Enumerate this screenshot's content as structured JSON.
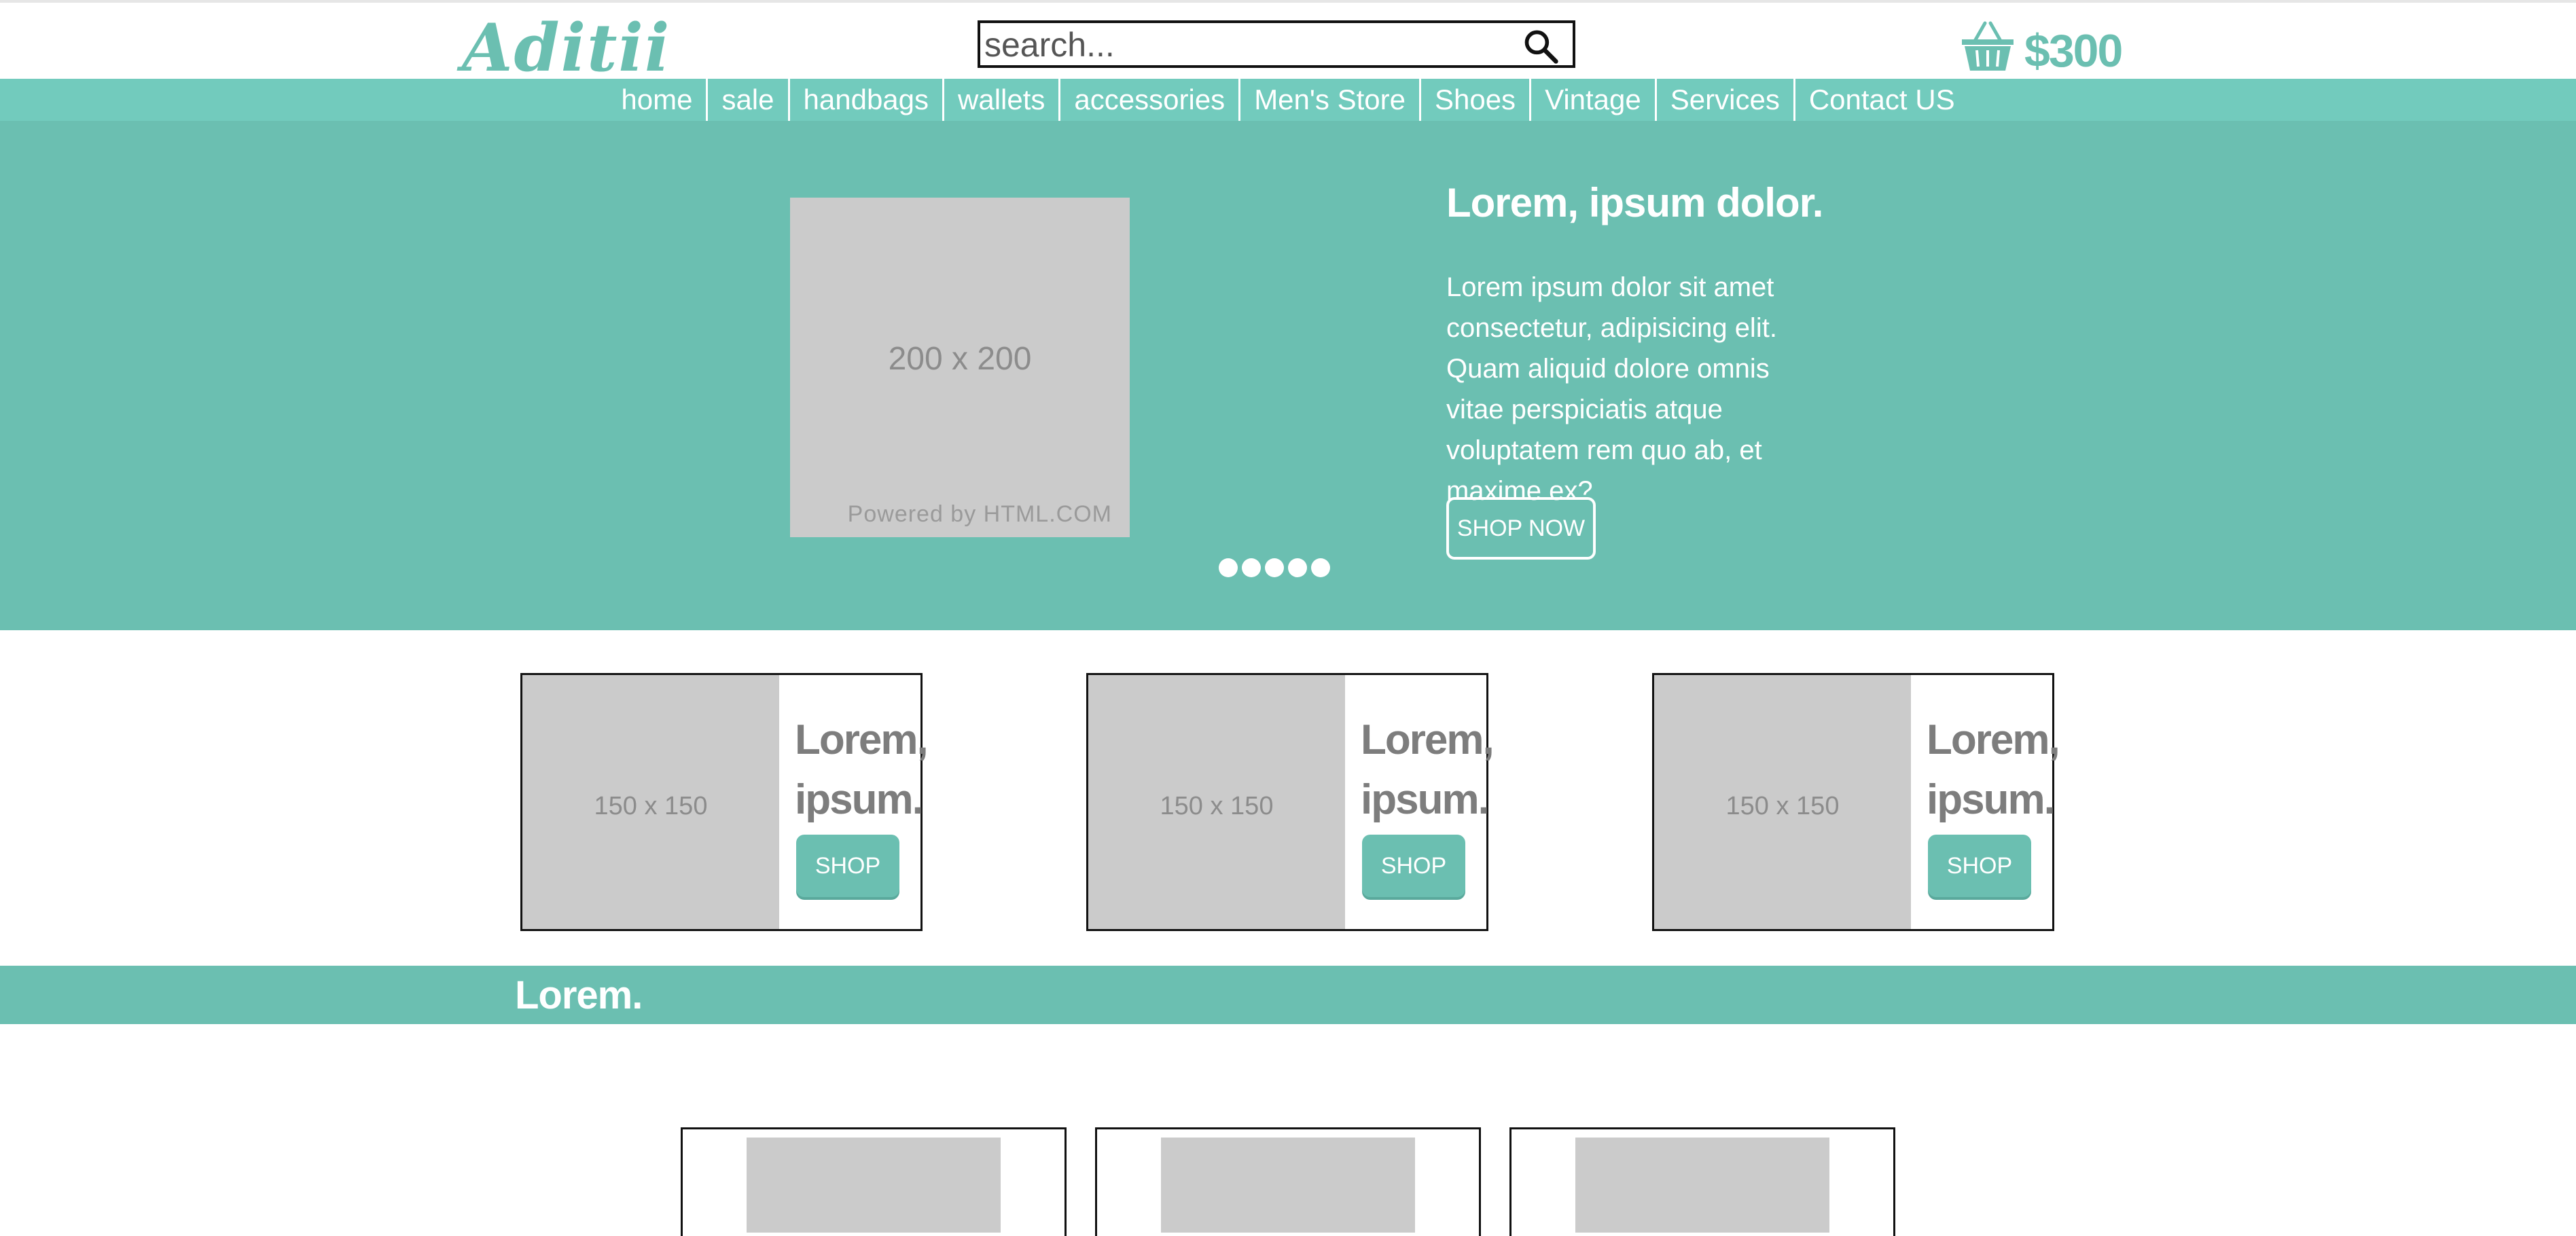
{
  "header": {
    "logo": "Aditii",
    "search_placeholder": "search...",
    "cart_total": "$300"
  },
  "nav": {
    "items": [
      "home",
      "sale",
      "handbags",
      "wallets",
      "accessories",
      "Men's Store",
      "Shoes",
      "Vintage",
      "Services",
      "Contact US"
    ]
  },
  "hero": {
    "image_label": "200 x 200",
    "image_credit": "Powered by HTML.COM",
    "title": "Lorem, ipsum dolor.",
    "text": "Lorem ipsum dolor sit amet consectetur, adipisicing elit. Quam aliquid dolore omnis vitae perspiciatis atque voluptatem rem quo ab, et maxime ex?",
    "button": "SHOP NOW",
    "slide_count": 5
  },
  "promos": [
    {
      "image_label": "150 x 150",
      "title": "Lorem, ipsum.",
      "button": "SHOP"
    },
    {
      "image_label": "150 x 150",
      "title": "Lorem, ipsum.",
      "button": "SHOP"
    },
    {
      "image_label": "150 x 150",
      "title": "Lorem, ipsum.",
      "button": "SHOP"
    }
  ],
  "section": {
    "title": "Lorem."
  },
  "colors": {
    "accent": "#6bbfb1",
    "nav": "#72cbbd",
    "placeholder": "#cbcbcb"
  },
  "icons": {
    "search": "search-icon",
    "cart": "basket-icon"
  }
}
